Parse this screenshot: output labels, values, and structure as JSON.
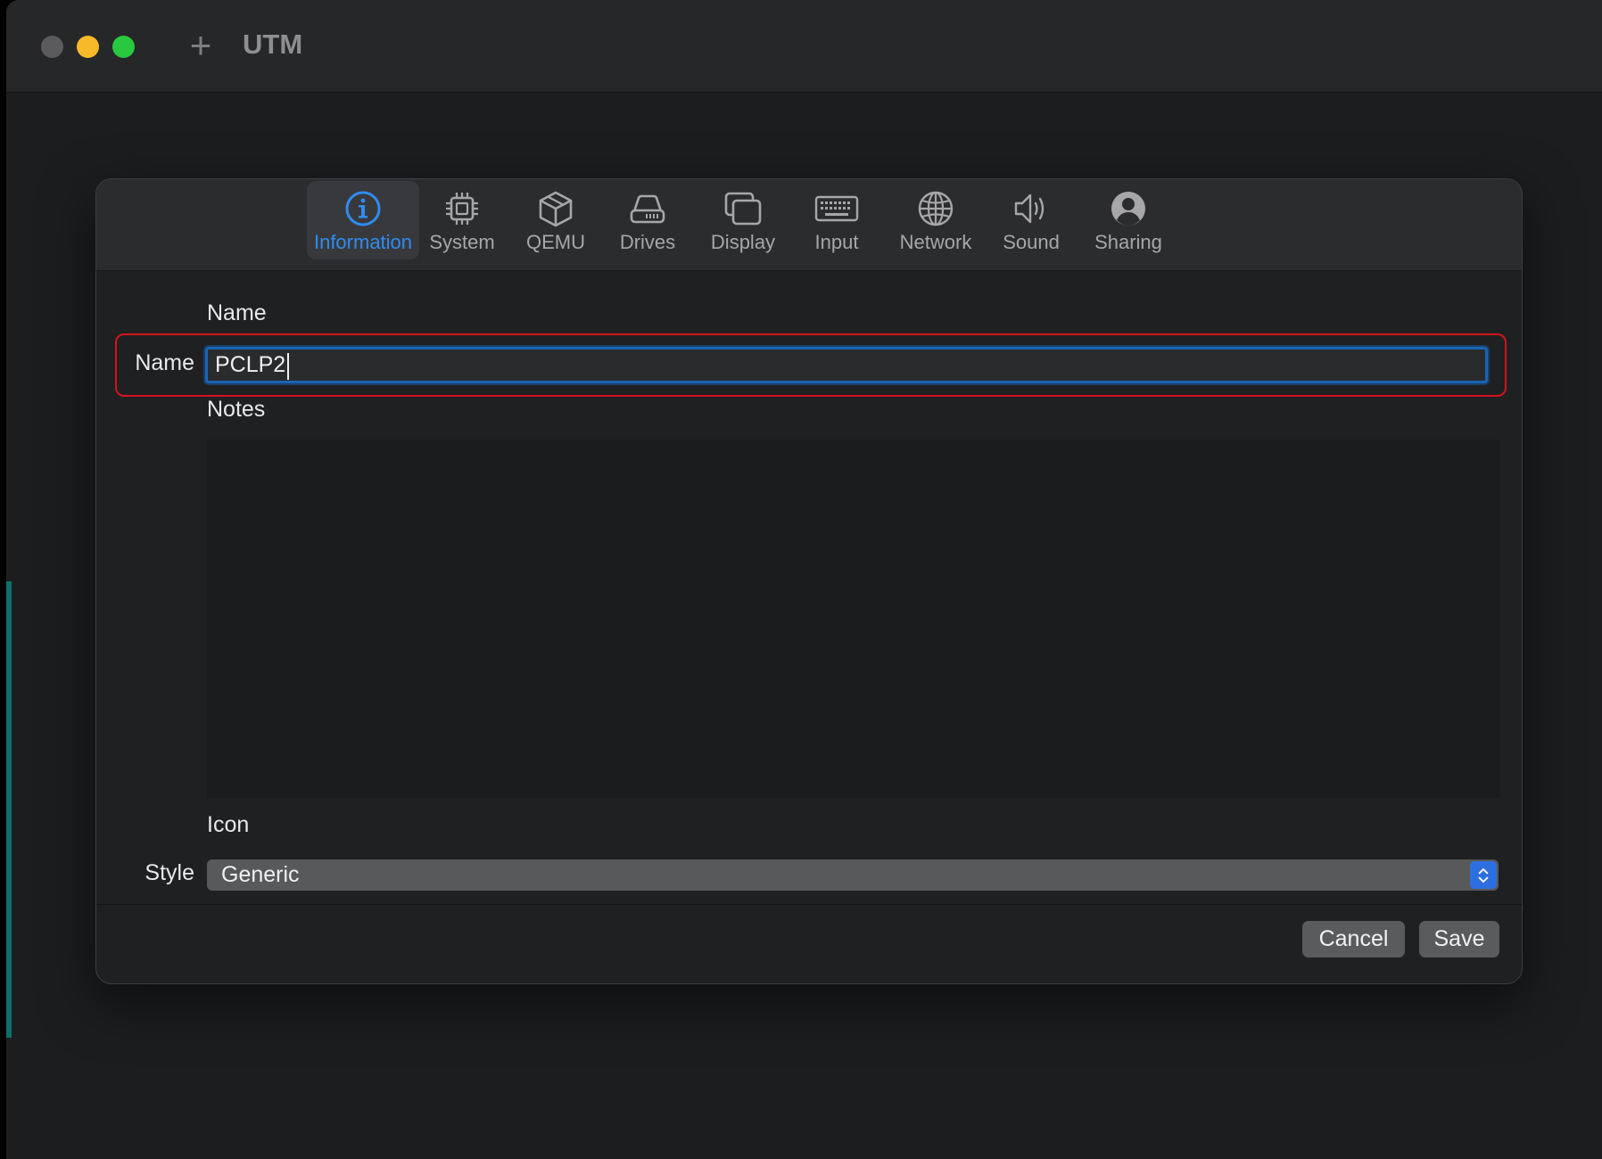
{
  "window": {
    "title": "UTM",
    "traffic_lights": [
      "close",
      "minimize",
      "zoom"
    ],
    "new_button_icon": "plus-icon"
  },
  "tabs": [
    {
      "label": "Information",
      "icon": "info-icon",
      "active": true
    },
    {
      "label": "System",
      "icon": "cpu-chip-icon",
      "active": false
    },
    {
      "label": "QEMU",
      "icon": "cube-icon",
      "active": false
    },
    {
      "label": "Drives",
      "icon": "drive-icon",
      "active": false
    },
    {
      "label": "Display",
      "icon": "display-windows-icon",
      "active": false
    },
    {
      "label": "Input",
      "icon": "keyboard-icon",
      "active": false
    },
    {
      "label": "Network",
      "icon": "globe-icon",
      "active": false
    },
    {
      "label": "Sound",
      "icon": "speaker-icon",
      "active": false
    },
    {
      "label": "Sharing",
      "icon": "person-circle-icon",
      "active": false
    }
  ],
  "form": {
    "name_section": "Name",
    "name_label": "Name",
    "name_value": "PCLP2",
    "notes_section": "Notes",
    "notes_value": "",
    "icon_section": "Icon",
    "style_label": "Style",
    "style_value": "Generic"
  },
  "footer": {
    "cancel_label": "Cancel",
    "save_label": "Save"
  },
  "colors": {
    "accent": "#2f8cf0",
    "highlight": "#d4141a",
    "select_stepper": "#2d6fe0"
  }
}
